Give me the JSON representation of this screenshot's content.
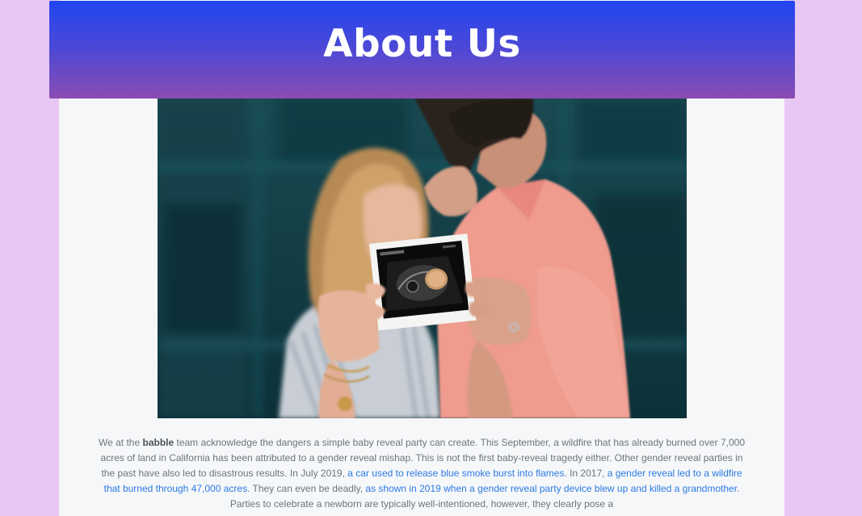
{
  "header": {
    "title": "About Us"
  },
  "hero_image": {
    "icon": "couple-ultrasound-photo"
  },
  "about": {
    "intro_before_brand": "We at the ",
    "brand": "babble",
    "intro_after_brand": " team acknowledge the dangers a simple baby reveal party can create. This September, a wildfire that has already burned over 7,000 acres of land in California has been attributed to a gender reveal mishap. This is not the first baby-reveal tragedy either. Other gender reveal parties in the past have also led to disastrous results. In July 2019, ",
    "link1": "a car used to release blue smoke burst into flames",
    "text2": ". In 2017, ",
    "link2": "a gender reveal led to a wildfire that burned through 47,000 acres",
    "text3": ". They can even be deadly, ",
    "link3": "as shown in 2019 when a gender reveal party device blew up and killed a grandmother",
    "text4": ". Parties to celebrate a newborn are typically well-intentioned, however, they clearly pose a"
  },
  "colors": {
    "page_background": "#e8c7f4",
    "card_background": "#f6f7f9",
    "header_gradient_top": "#2146f0",
    "header_gradient_bottom": "#8a4cb2",
    "link": "#2a7be4",
    "body_text": "#6d747c"
  }
}
